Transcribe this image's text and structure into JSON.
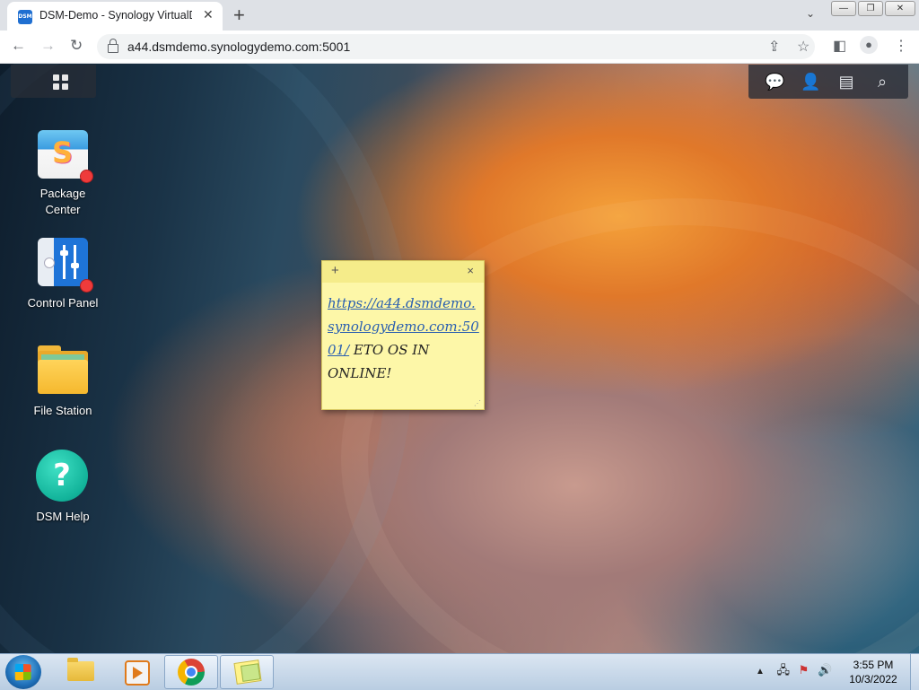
{
  "browser": {
    "tab_title": "DSM-Demo - Synology VirtualDSM",
    "tab_favicon_text": "DSM",
    "url": "a44.dsmdemo.synologydemo.com:5001",
    "icons": [
      "back-icon",
      "forward-icon",
      "reload-icon",
      "lock-icon",
      "share-icon",
      "star-icon",
      "sidepanel-icon",
      "profile-icon",
      "menu-icon"
    ]
  },
  "desktop": {
    "icons": [
      {
        "label": "Package\nCenter",
        "line1": "Package",
        "line2": "Center",
        "has_badge": true
      },
      {
        "label": "Control Panel",
        "has_badge": true
      },
      {
        "label": "File Station",
        "has_badge": false
      },
      {
        "label": "DSM Help",
        "has_badge": false
      }
    ],
    "topbar_icons": [
      "main-menu-icon",
      "chat-icon",
      "user-icon",
      "widgets-icon",
      "search-icon"
    ]
  },
  "sticky_note": {
    "add_symbol": "+",
    "close_symbol": "×",
    "link_text": "https://a44.dsmdemo.synologydemo.com:5001/",
    "body_text": " ETO OS IN ONLINE!"
  },
  "taskbar": {
    "apps": [
      "windows-explorer",
      "media-player",
      "chrome",
      "sticky-notes"
    ],
    "time": "3:55 PM",
    "date": "10/3/2022"
  }
}
